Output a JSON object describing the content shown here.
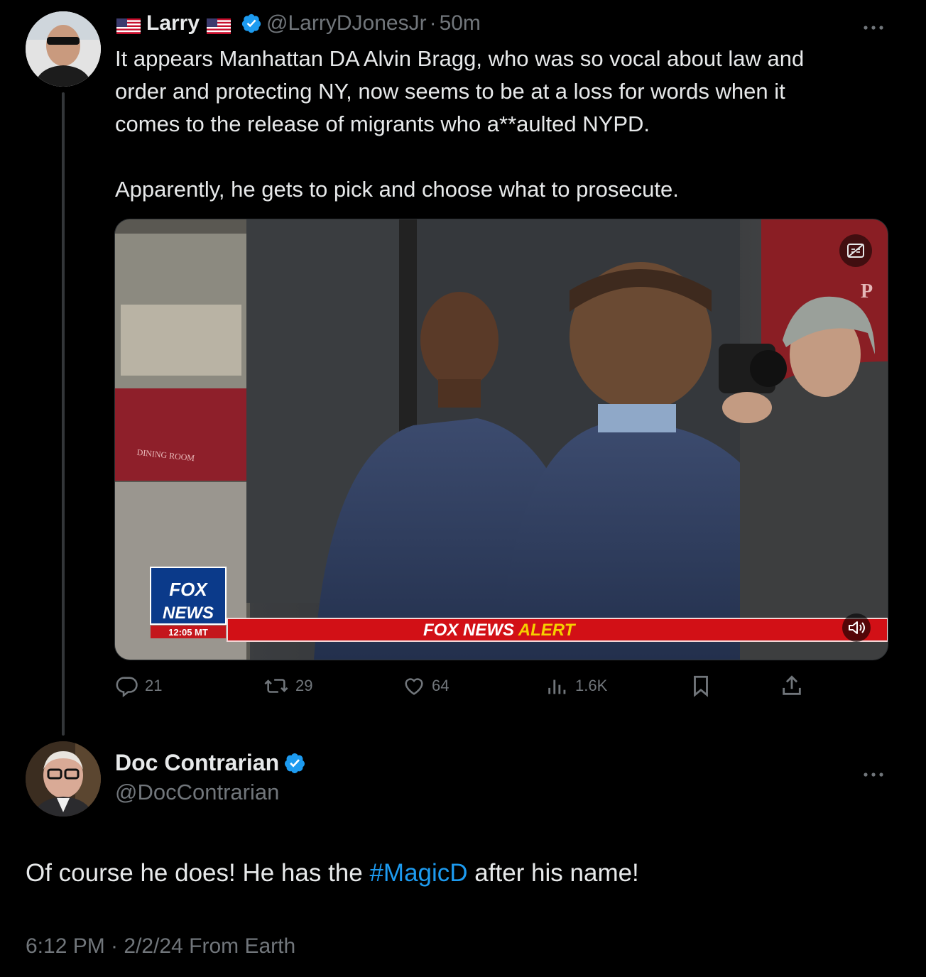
{
  "tweet1": {
    "display_name": "Larry",
    "handle": "@LarryDJonesJr",
    "separator": "·",
    "time": "50m",
    "text_lines": [
      "It appears Manhattan DA Alvin Bragg, who was so vocal about law and",
      "order and protecting NY, now seems to be at a loss for words when it",
      "comes to the release of migrants who a**aulted NYPD."
    ],
    "text_line2": "Apparently, he gets to pick and choose what to prosecute.",
    "more_icon": "more-icon",
    "video": {
      "logo_top": "FOX",
      "logo_bottom": "NEWS",
      "logo_time": "12:05 MT",
      "banner_left": "FOX NEWS",
      "banner_right": "ALERT",
      "sign_text": "DINING ROOM",
      "corner_text": "P"
    },
    "actions": {
      "replies": "21",
      "reposts": "29",
      "likes": "64",
      "views": "1.6K"
    }
  },
  "tweet2": {
    "display_name": "Doc Contrarian",
    "handle": "@DocContrarian",
    "text_before": "Of course he does! He has the ",
    "hashtag": "#MagicD",
    "text_after": " after his name!",
    "meta": "6:12 PM · 2/2/24 From Earth"
  },
  "colors": {
    "background": "#000000",
    "text": "#e7e9ea",
    "muted": "#71767b",
    "accent": "#1d9bf0"
  }
}
